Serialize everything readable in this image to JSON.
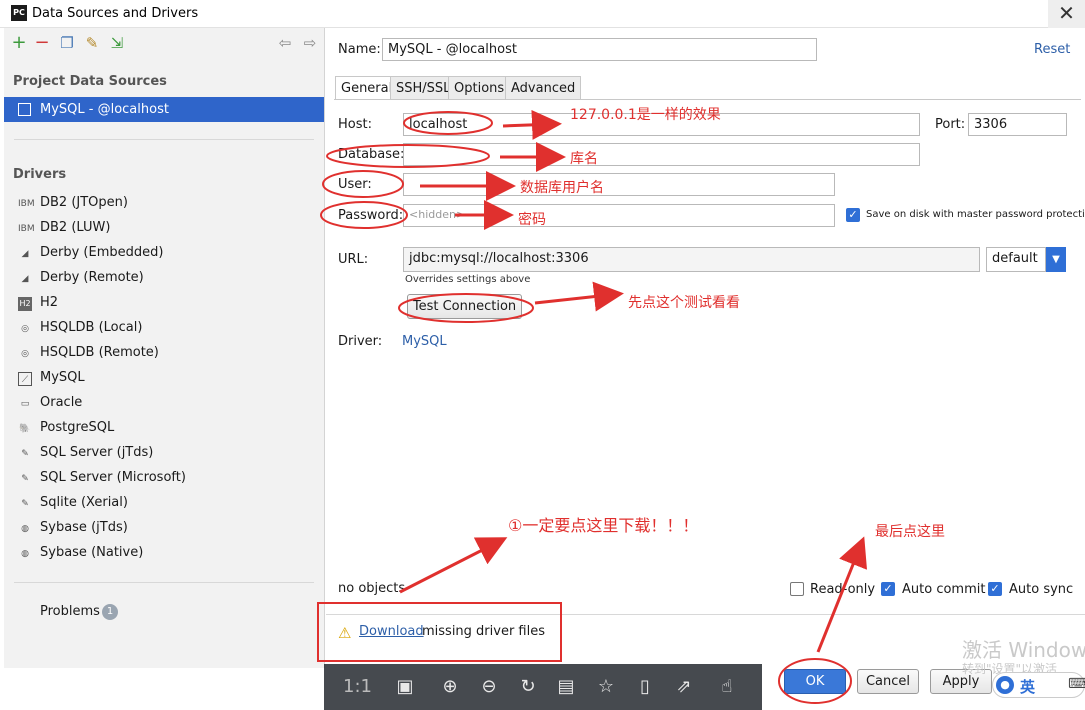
{
  "window": {
    "app_icon_text": "PC",
    "title": "Data Sources and Drivers",
    "close_symbol": "✕"
  },
  "left": {
    "toolbar": [
      "add-icon",
      "remove-icon",
      "duplicate-icon",
      "properties-icon",
      "import-icon",
      "back-icon",
      "forward-icon"
    ],
    "project_section": "Project Data Sources",
    "selected_source": "MySQL - @localhost",
    "drivers_section": "Drivers",
    "drivers": [
      {
        "label": "DB2 (JTOpen)",
        "icon": "IBM"
      },
      {
        "label": "DB2 (LUW)",
        "icon": "IBM"
      },
      {
        "label": "Derby (Embedded)",
        "icon": "◢"
      },
      {
        "label": "Derby (Remote)",
        "icon": "◢"
      },
      {
        "label": "H2",
        "icon": "H2"
      },
      {
        "label": "HSQLDB (Local)",
        "icon": "◎"
      },
      {
        "label": "HSQLDB (Remote)",
        "icon": "◎"
      },
      {
        "label": "MySQL",
        "icon": "⟋"
      },
      {
        "label": "Oracle",
        "icon": "▭"
      },
      {
        "label": "PostgreSQL",
        "icon": "🐘"
      },
      {
        "label": "SQL Server (jTds)",
        "icon": "✎"
      },
      {
        "label": "SQL Server (Microsoft)",
        "icon": "✎"
      },
      {
        "label": "Sqlite (Xerial)",
        "icon": "✎"
      },
      {
        "label": "Sybase (jTds)",
        "icon": "◍"
      },
      {
        "label": "Sybase (Native)",
        "icon": "◍"
      }
    ],
    "problems_label": "Problems",
    "problems_count": "1"
  },
  "form": {
    "name_label": "Name:",
    "name_value": "MySQL - @localhost",
    "reset_label": "Reset",
    "tabs": [
      "General",
      "SSH/SSL",
      "Options",
      "Advanced"
    ],
    "host_label": "Host:",
    "host_value": "localhost",
    "port_label": "Port:",
    "port_value": "3306",
    "database_label": "Database:",
    "database_value": "",
    "user_label": "User:",
    "user_value": "",
    "password_label": "Password:",
    "password_value": "<hidden>",
    "save_on_disk_label": "Save on disk with master password protection",
    "url_label": "URL:",
    "url_value": "jdbc:mysql://localhost:3306",
    "url_mode": "default",
    "url_hint": "Overrides settings above",
    "test_connection_label": "Test Connection",
    "driver_label": "Driver:",
    "driver_value": "MySQL",
    "status_text": "no objects",
    "read_only_label": "Read-only",
    "auto_commit_label": "Auto commit",
    "auto_sync_label": "Auto sync",
    "download_link": "Download",
    "download_rest": "missing driver files"
  },
  "buttons": {
    "ok": "OK",
    "cancel": "Cancel",
    "apply": "Apply"
  },
  "annotations": {
    "host": "127.0.0.1是一样的效果",
    "database": "库名",
    "user": "数据库用户名",
    "password": "密码",
    "test": "先点这个测试看看",
    "download": "①一定要点这里下载！！！",
    "ok": "最后点这里"
  },
  "viewer_toolbar": {
    "ratio_label": "1:1",
    "icons": [
      "fit-screen-icon",
      "zoom-in-icon",
      "zoom-out-icon",
      "rotate-icon",
      "save-icon",
      "bookmark-icon",
      "phone-icon",
      "share-icon",
      "like-icon"
    ]
  },
  "watermark": {
    "line1": "激活 Window",
    "line2": "转到\"设置\"以激活"
  },
  "ime": {
    "label": "英"
  },
  "colors": {
    "selection": "#2f65ca",
    "annotation": "#e0302e",
    "link": "#2d5fa8"
  }
}
